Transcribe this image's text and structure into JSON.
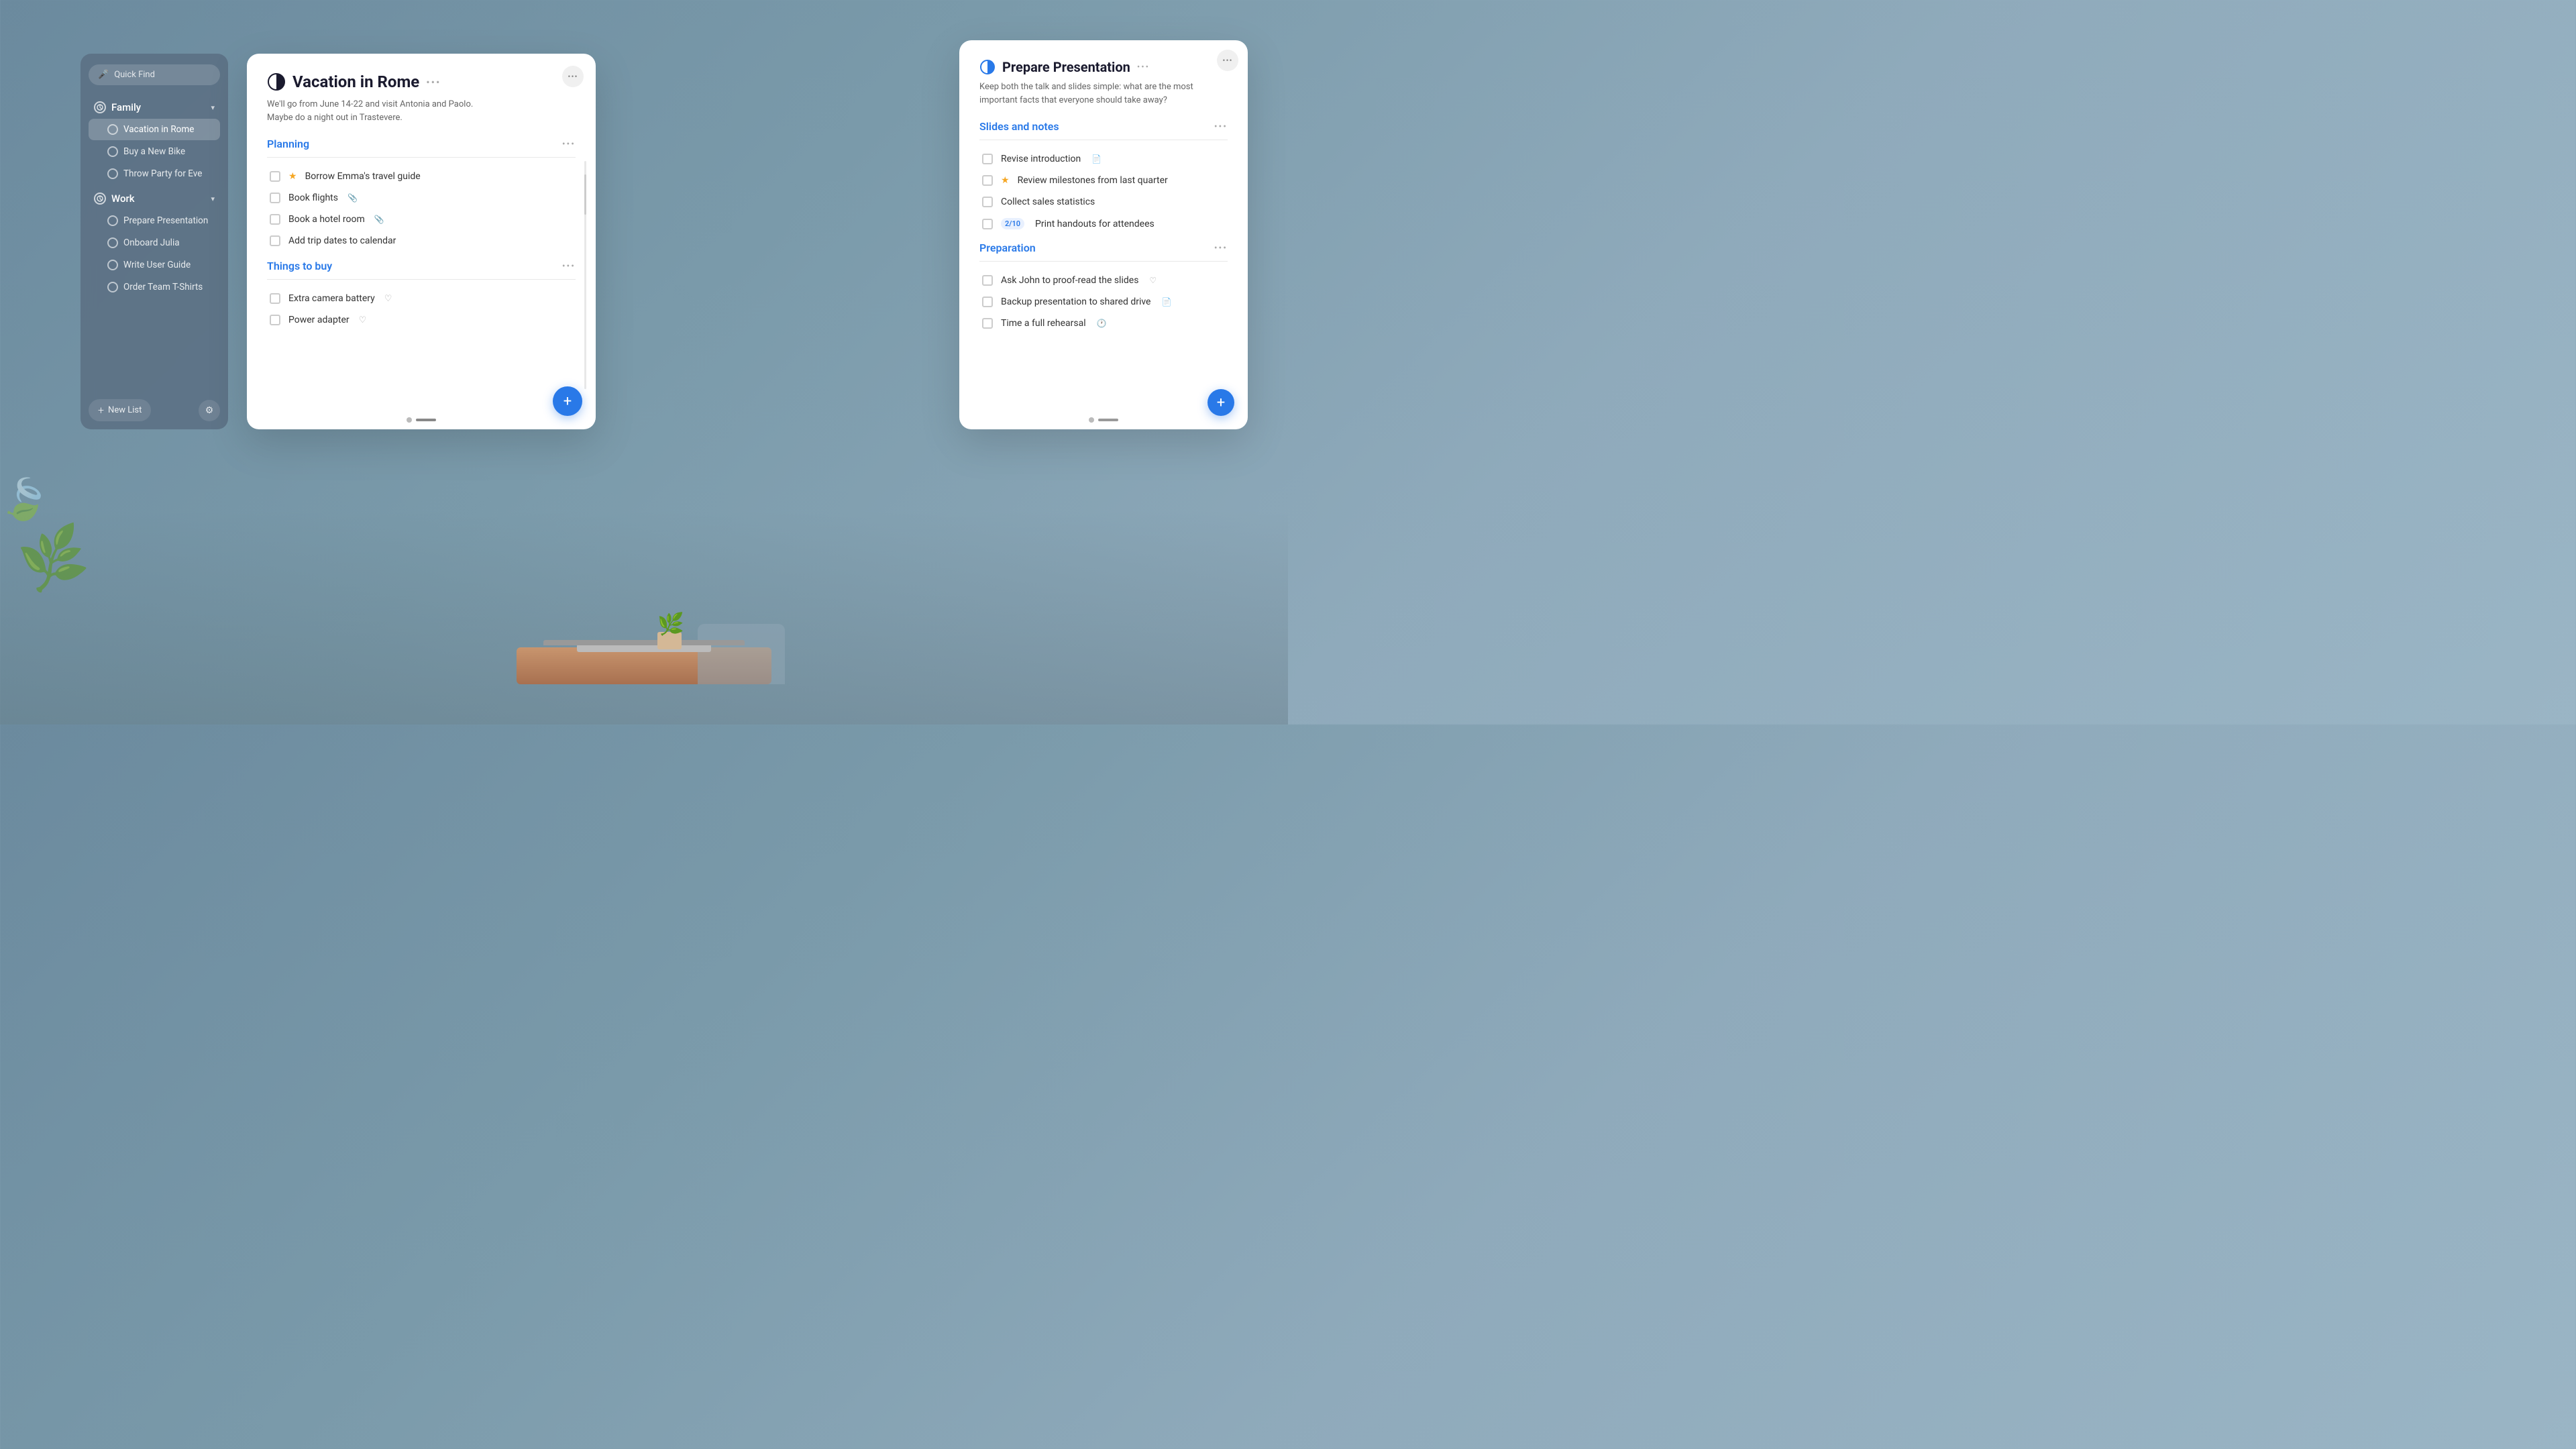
{
  "background": {
    "color": "#7a9aaa"
  },
  "sidebar": {
    "search_placeholder": "Quick Find",
    "groups": [
      {
        "id": "family",
        "label": "Family",
        "expanded": true,
        "items": [
          {
            "id": "vacation-rome",
            "label": "Vacation in Rome",
            "active": true
          },
          {
            "id": "buy-bike",
            "label": "Buy a New Bike",
            "active": false
          }
        ]
      },
      {
        "id": "work",
        "label": "Work",
        "expanded": true,
        "items": [
          {
            "id": "prepare-presentation",
            "label": "Prepare Presentation",
            "active": false
          },
          {
            "id": "onboard-julia",
            "label": "Onboard Julia",
            "active": false
          },
          {
            "id": "write-user-guide",
            "label": "Write User Guide",
            "active": false
          },
          {
            "id": "order-tshirts",
            "label": "Order Team T-Shirts",
            "active": false
          }
        ]
      }
    ],
    "new_list_label": "New List",
    "sidebar_also_contains_throw_party": {
      "id": "throw-party-eve",
      "label": "Throw Party for Eve",
      "active": false
    }
  },
  "vacation_card": {
    "title": "Vacation in Rome",
    "description": "We'll go from June 14-22 and visit Antonia and Paolo.\nMaybe do a night out in Trastevere.",
    "sections": [
      {
        "id": "planning",
        "title": "Planning",
        "tasks": [
          {
            "id": "t1",
            "text": "Borrow Emma's travel guide",
            "starred": true,
            "checked": false,
            "has_attachment": false
          },
          {
            "id": "t2",
            "text": "Book flights",
            "starred": false,
            "checked": false,
            "has_attachment": true
          },
          {
            "id": "t3",
            "text": "Book a hotel room",
            "starred": false,
            "checked": false,
            "has_attachment": true
          },
          {
            "id": "t4",
            "text": "Add trip dates to calendar",
            "starred": false,
            "checked": false,
            "has_attachment": false
          }
        ]
      },
      {
        "id": "things-to-buy",
        "title": "Things to buy",
        "tasks": [
          {
            "id": "t5",
            "text": "Extra camera battery",
            "starred": false,
            "checked": false,
            "has_attachment": true
          },
          {
            "id": "t6",
            "text": "Power adapter",
            "starred": false,
            "checked": false,
            "has_attachment": true
          }
        ]
      }
    ]
  },
  "presentation_card": {
    "title": "Prepare Presentation",
    "description": "Keep both the talk and slides simple: what are the most important facts that everyone should take away?",
    "sections": [
      {
        "id": "slides-notes",
        "title": "Slides and notes",
        "tasks": [
          {
            "id": "p1",
            "text": "Revise introduction",
            "starred": false,
            "checked": false,
            "has_attachment": true
          },
          {
            "id": "p2",
            "text": "Review milestones from last quarter",
            "starred": true,
            "checked": false,
            "has_attachment": false
          },
          {
            "id": "p3",
            "text": "Collect sales statistics",
            "starred": false,
            "checked": false,
            "has_attachment": false
          },
          {
            "id": "p4",
            "text": "Print handouts for attendees",
            "starred": false,
            "checked": false,
            "has_badge": true,
            "badge_text": "2/10",
            "has_attachment": false
          }
        ]
      },
      {
        "id": "preparation",
        "title": "Preparation",
        "tasks": [
          {
            "id": "p5",
            "text": "Ask John to proof-read the slides",
            "starred": false,
            "checked": false,
            "has_attachment": true
          },
          {
            "id": "p6",
            "text": "Backup presentation to shared drive",
            "starred": false,
            "checked": false,
            "has_attachment": true
          },
          {
            "id": "p7",
            "text": "Time a full rehearsal",
            "starred": false,
            "checked": false,
            "has_attachment": true
          }
        ]
      }
    ]
  },
  "icons": {
    "mic": "🎤",
    "chevron_down": "▾",
    "plus": "+",
    "gear": "⚙",
    "dots": "•••",
    "star": "★",
    "clip": "📎",
    "circle_half": "◑"
  }
}
